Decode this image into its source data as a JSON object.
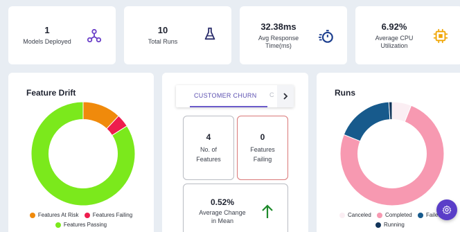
{
  "kpis": [
    {
      "value": "1",
      "label": "Models Deployed",
      "icon": "model-network-icon"
    },
    {
      "value": "10",
      "label": "Total Runs",
      "icon": "flask-icon"
    },
    {
      "value": "32.38ms",
      "label_line1": "Avg Response",
      "label_line2": "Time(ms)",
      "icon": "stopwatch-icon"
    },
    {
      "value": "6.92%",
      "label_line1": "Average CPU",
      "label_line2": "Utilization",
      "icon": "cpu-chip-icon"
    }
  ],
  "feature_drift": {
    "title": "Feature Drift",
    "legend": [
      "Features At Risk",
      "Features Failing",
      "Features Passing"
    ],
    "colors": {
      "at_risk": "#f08a0b",
      "failing": "#ee1d4d",
      "passing": "#7be91c"
    }
  },
  "model_tabs": {
    "active_tab": "CUSTOMER CHURN",
    "next_tab_partial": "C",
    "stats": [
      {
        "value": "4",
        "label_line1": "No. of",
        "label_line2": "Features"
      },
      {
        "value": "0",
        "label_line1": "Features",
        "label_line2": "Failing"
      },
      {
        "value": "0.52%",
        "label_line1": "Average Change",
        "label_line2": "in Mean"
      }
    ]
  },
  "runs": {
    "title": "Runs",
    "legend": [
      "Canceled",
      "Completed",
      "Failed",
      "Running"
    ],
    "colors": {
      "canceled": "#fbeef3",
      "completed": "#f799b1",
      "failed": "#175a8c",
      "running": "#12345a"
    }
  },
  "chart_data": [
    {
      "type": "pie",
      "title": "Feature Drift",
      "categories": [
        "Features At Risk",
        "Features Failing",
        "Features Passing"
      ],
      "values": [
        12,
        4,
        84
      ],
      "colors": [
        "#f08a0b",
        "#ee1d4d",
        "#7be91c"
      ],
      "legend": "bottom"
    },
    {
      "type": "pie",
      "title": "Runs",
      "categories": [
        "Canceled",
        "Completed",
        "Failed",
        "Running"
      ],
      "values": [
        6,
        75,
        18,
        1
      ],
      "colors": [
        "#fbeef3",
        "#f799b1",
        "#175a8c",
        "#12345a"
      ],
      "legend": "bottom"
    }
  ]
}
